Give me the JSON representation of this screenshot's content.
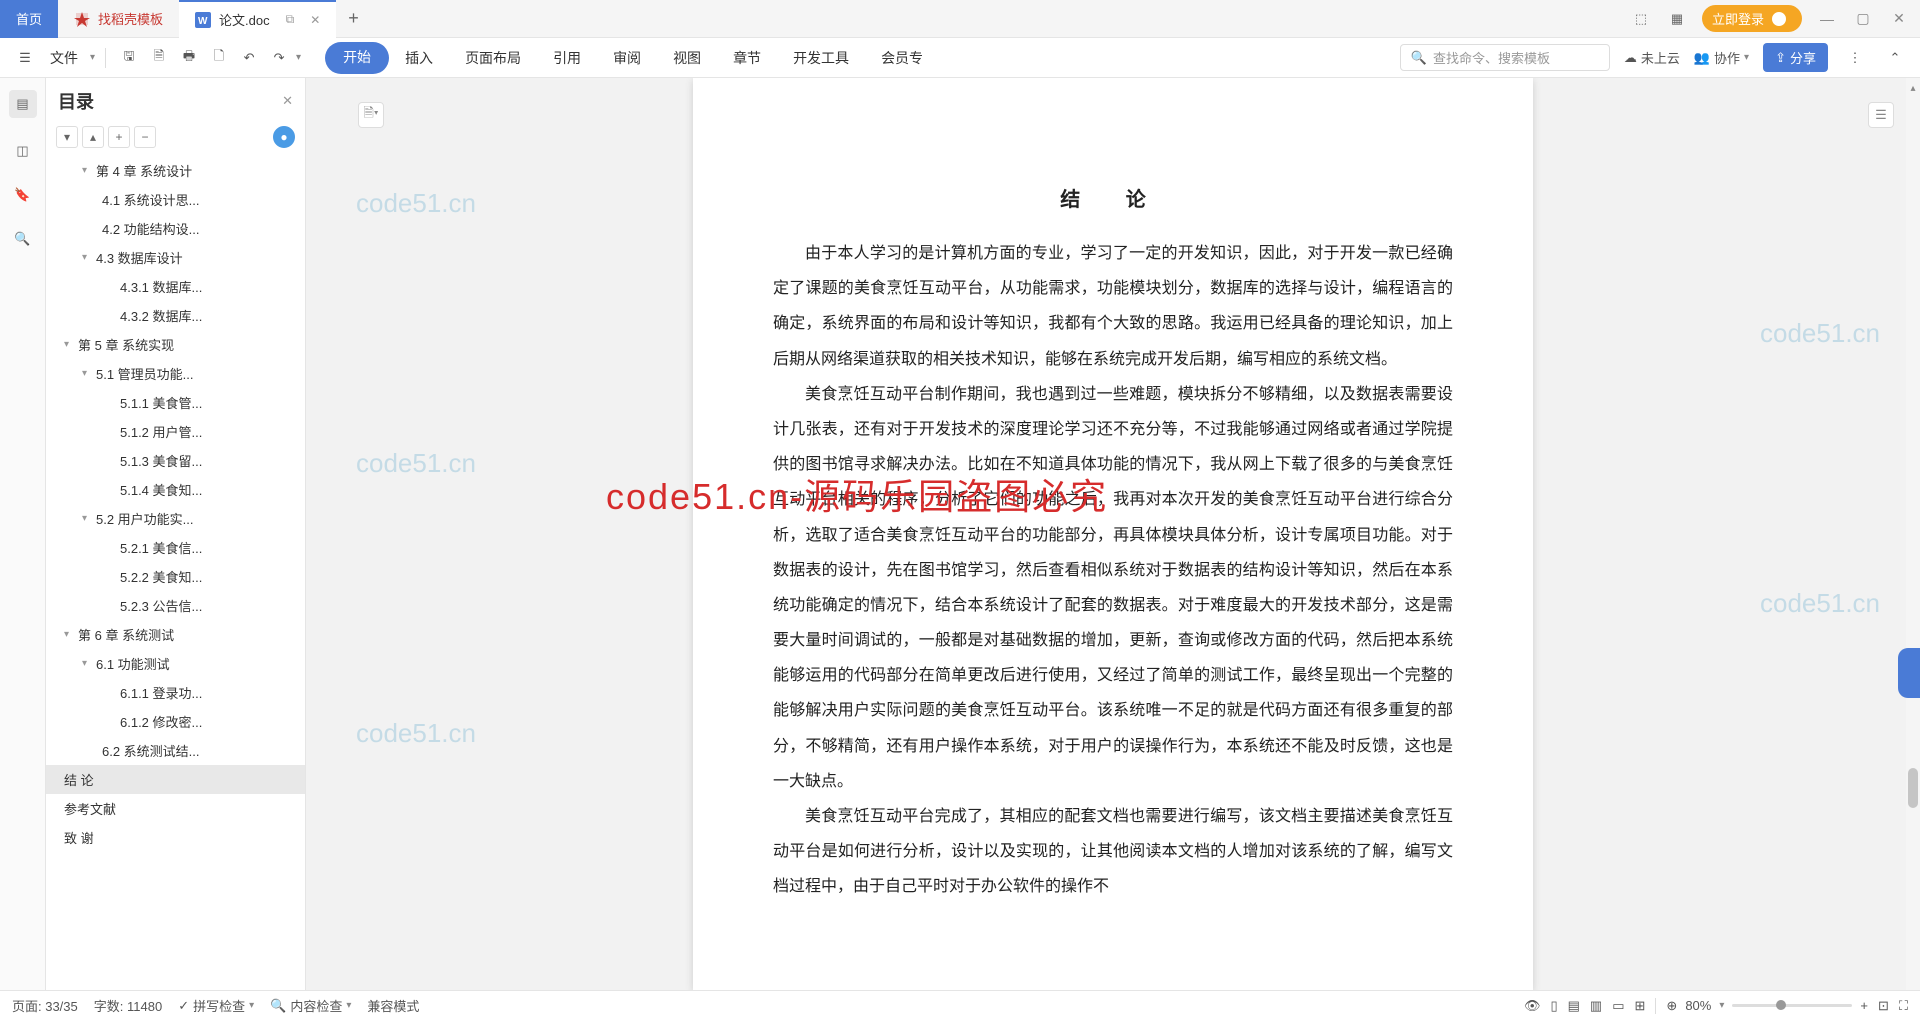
{
  "titlebar": {
    "home_tab": "首页",
    "template_tab": "找稻壳模板",
    "doc_tab": "论文.doc",
    "login": "立即登录"
  },
  "toolbar": {
    "file": "文件",
    "search_placeholder": "查找命令、搜索模板",
    "cloud": "未上云",
    "collab": "协作",
    "share": "分享",
    "menu": [
      "开始",
      "插入",
      "页面布局",
      "引用",
      "审阅",
      "视图",
      "章节",
      "开发工具",
      "会员专"
    ]
  },
  "sidebar": {
    "title": "目录",
    "items": [
      {
        "lv": 2,
        "chev": "▾",
        "txt": "第 4 章  系统设计"
      },
      {
        "lv": 3,
        "txt": "4.1  系统设计思..."
      },
      {
        "lv": 3,
        "txt": "4.2  功能结构设..."
      },
      {
        "lv": 2,
        "chev": "▾",
        "txt": "4.3  数据库设计"
      },
      {
        "lv": 4,
        "txt": "4.3.1  数据库..."
      },
      {
        "lv": 4,
        "txt": "4.3.2  数据库..."
      },
      {
        "lv": 1,
        "chev": "▾",
        "txt": "第 5 章   系统实现"
      },
      {
        "lv": 2,
        "chev": "▾",
        "txt": "5.1  管理员功能..."
      },
      {
        "lv": 4,
        "txt": "5.1.1  美食管..."
      },
      {
        "lv": 4,
        "txt": "5.1.2  用户管..."
      },
      {
        "lv": 4,
        "txt": "5.1.3  美食留..."
      },
      {
        "lv": 4,
        "txt": "5.1.4  美食知..."
      },
      {
        "lv": 2,
        "chev": "▾",
        "txt": "5.2  用户功能实..."
      },
      {
        "lv": 4,
        "txt": "5.2.1  美食信..."
      },
      {
        "lv": 4,
        "txt": "5.2.2  美食知..."
      },
      {
        "lv": 4,
        "txt": "5.2.3  公告信..."
      },
      {
        "lv": 1,
        "chev": "▾",
        "txt": "第 6 章  系统测试"
      },
      {
        "lv": 2,
        "chev": "▾",
        "txt": "6.1  功能测试"
      },
      {
        "lv": 4,
        "txt": "6.1.1  登录功..."
      },
      {
        "lv": 4,
        "txt": "6.1.2  修改密..."
      },
      {
        "lv": 3,
        "txt": "6.2  系统测试结..."
      },
      {
        "lv": 1,
        "txt": "结   论",
        "sel": true
      },
      {
        "lv": 1,
        "txt": "参考文献"
      },
      {
        "lv": 1,
        "txt": "致   谢"
      }
    ]
  },
  "document": {
    "title": "结   论",
    "p1": "由于本人学习的是计算机方面的专业，学习了一定的开发知识，因此，对于开发一款已经确定了课题的美食烹饪互动平台，从功能需求，功能模块划分，数据库的选择与设计，编程语言的确定，系统界面的布局和设计等知识，我都有个大致的思路。我运用已经具备的理论知识，加上后期从网络渠道获取的相关技术知识，能够在系统完成开发后期，编写相应的系统文档。",
    "p2": "美食烹饪互动平台制作期间，我也遇到过一些难题，模块拆分不够精细，以及数据表需要设计几张表，还有对于开发技术的深度理论学习还不充分等，不过我能够通过网络或者通过学院提供的图书馆寻求解决办法。比如在不知道具体功能的情况下，我从网上下载了很多的与美食烹饪互动平台相关的程序，分析了它们的功能之后，我再对本次开发的美食烹饪互动平台进行综合分析，选取了适合美食烹饪互动平台的功能部分，再具体模块具体分析，设计专属项目功能。对于数据表的设计，先在图书馆学习，然后查看相似系统对于数据表的结构设计等知识，然后在本系统功能确定的情况下，结合本系统设计了配套的数据表。对于难度最大的开发技术部分，这是需要大量时间调试的，一般都是对基础数据的增加，更新，查询或修改方面的代码，然后把本系统能够运用的代码部分在简单更改后进行使用，又经过了简单的测试工作，最终呈现出一个完整的能够解决用户实际问题的美食烹饪互动平台。该系统唯一不足的就是代码方面还有很多重复的部分，不够精简，还有用户操作本系统，对于用户的误操作行为，本系统还不能及时反馈，这也是一大缺点。",
    "p3": "美食烹饪互动平台完成了，其相应的配套文档也需要进行编写，该文档主要描述美食烹饪互动平台是如何进行分析，设计以及实现的，让其他阅读本文档的人增加对该系统的了解，编写文档过程中，由于自己平时对于办公软件的操作不"
  },
  "watermark": {
    "text": "code51.cn",
    "red": "code51.cn-源码乐园盗图必究"
  },
  "status": {
    "page": "页面: 33/35",
    "words": "字数: 11480",
    "spell": "拼写检查",
    "content": "内容检查",
    "compat": "兼容模式",
    "zoom": "80%"
  }
}
